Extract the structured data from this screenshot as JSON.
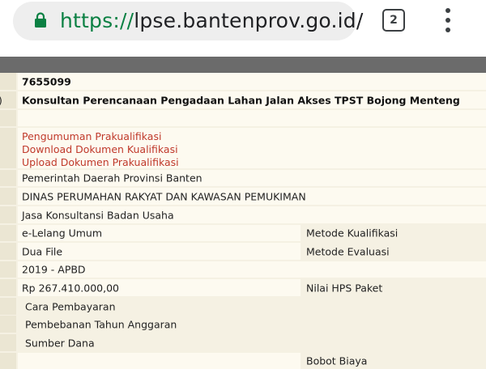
{
  "browser": {
    "url_scheme": "https://",
    "url_host": "lpse.bantenprov.go.id/",
    "tab_count": "2"
  },
  "tender": {
    "id": "7655099",
    "name_prefix": ")",
    "name": "Konsultan Perencanaan Pengadaan Lahan Jalan Akses TPST Bojong Menteng",
    "links": [
      "Pengumuman Prakualifikasi",
      "Download Dokumen Kualifikasi",
      "Upload Dokumen Prakualifikasi"
    ],
    "instansi": "Pemerintah Daerah Provinsi Banten",
    "satker": "DINAS PERUMAHAN RAKYAT DAN KAWASAN PEMUKIMAN",
    "kategori": "Jasa Konsultansi Badan Usaha",
    "metode_pengadaan": "e-Lelang Umum",
    "metode_kualifikasi_label": "Metode Kualifikasi",
    "metode_dokumen": "Dua File",
    "metode_evaluasi_label": "Metode Evaluasi",
    "anggaran": "2019 - APBD",
    "nilai_pagu": "Rp 267.410.000,00",
    "nilai_hps_label": "Nilai HPS Paket",
    "cara_pembayaran_label": "Cara Pembayaran",
    "pembebanan_label": "Pembebanan Tahun Anggaran",
    "sumber_dana_label": "Sumber Dana",
    "bobot_biaya_label": "Bobot Biaya"
  }
}
